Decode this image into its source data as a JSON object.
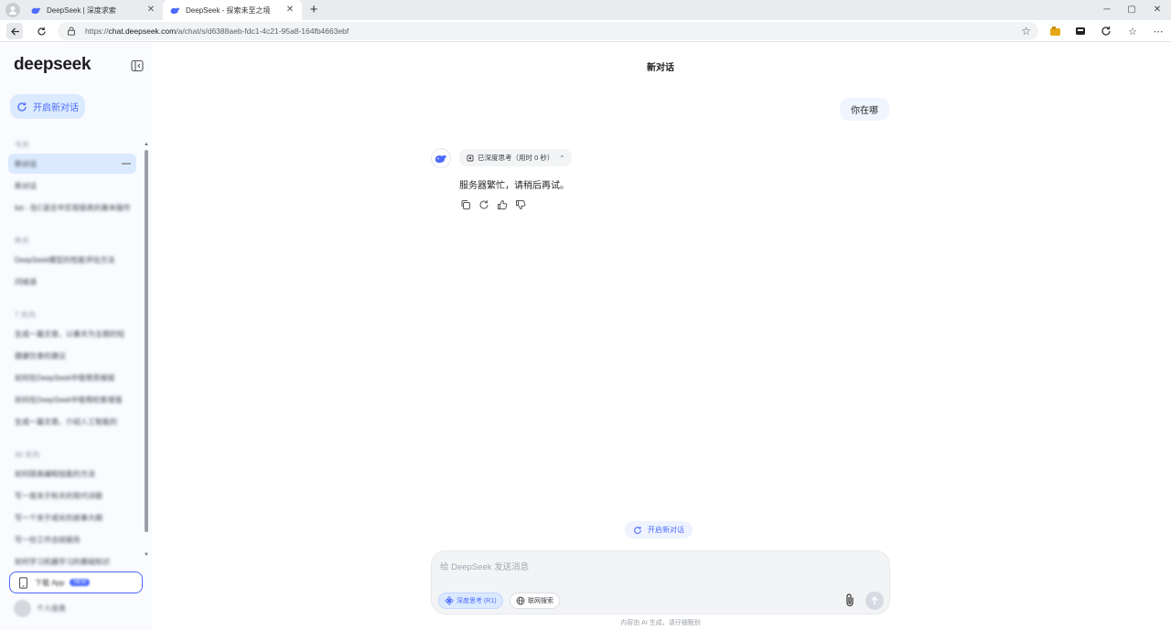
{
  "browser": {
    "tabs": [
      {
        "title": "DeepSeek | 深度求索",
        "active": false
      },
      {
        "title": "DeepSeek - 探索未至之境",
        "active": true
      }
    ],
    "new_tab_icon": "plus-icon",
    "window_controls": {
      "minimize": "─",
      "maximize": "▢",
      "close": "✕"
    },
    "url_prefix": "https://",
    "url_host": "chat.deepseek.com",
    "url_path": "/a/chat/s/d6388aeb-fdc1-4c21-95a8-164fb4663ebf"
  },
  "sidebar": {
    "logo": "deepseek",
    "new_chat_label": "开启新对话",
    "sections": [
      {
        "label": "今天",
        "items": [
          "新对话",
          "新对话",
          "list - 在C语言中实现链表的基本操作"
        ]
      },
      {
        "label": "昨天",
        "items": [
          "DeepSeek模型的性能评估方法",
          "问候语"
        ]
      },
      {
        "label": "7 天内",
        "items": [
          "生成一篇文章，以春天为主题的短",
          "健康饮食的建议",
          "如何在DeepSeek中使用思维链",
          "如何在DeepSeek中使用检索增强",
          "生成一篇文章，介绍人工智能的"
        ]
      },
      {
        "label": "30 天内",
        "items": [
          "如何提高编程技能的方法",
          "写一首关于秋天的现代诗歌",
          "写一个关于成长的故事大纲",
          "写一份工作总结报告",
          "如何学习机器学习的基础知识"
        ]
      }
    ],
    "get_app_label": "下载 App",
    "get_app_badge": "NEW",
    "profile_name": "个人信息"
  },
  "main": {
    "title": "新对话",
    "user_message": "你在哪",
    "thinking_label": "已深度思考（用时 0 秒）",
    "ai_message": "服务器繁忙，请稍后再试。",
    "new_chat_float_label": "开启新对话",
    "composer": {
      "placeholder": "给 DeepSeek 发送消息",
      "deep_think_label": "深度思考 (R1)",
      "web_search_label": "联网搜索"
    },
    "disclaimer": "内容由 AI 生成，请仔细甄别"
  },
  "colors": {
    "accent": "#4d6bfe",
    "accent_soft": "#dbeafe",
    "sidebar_bg": "#f9fbff",
    "composer_bg": "#f3f4f6"
  }
}
